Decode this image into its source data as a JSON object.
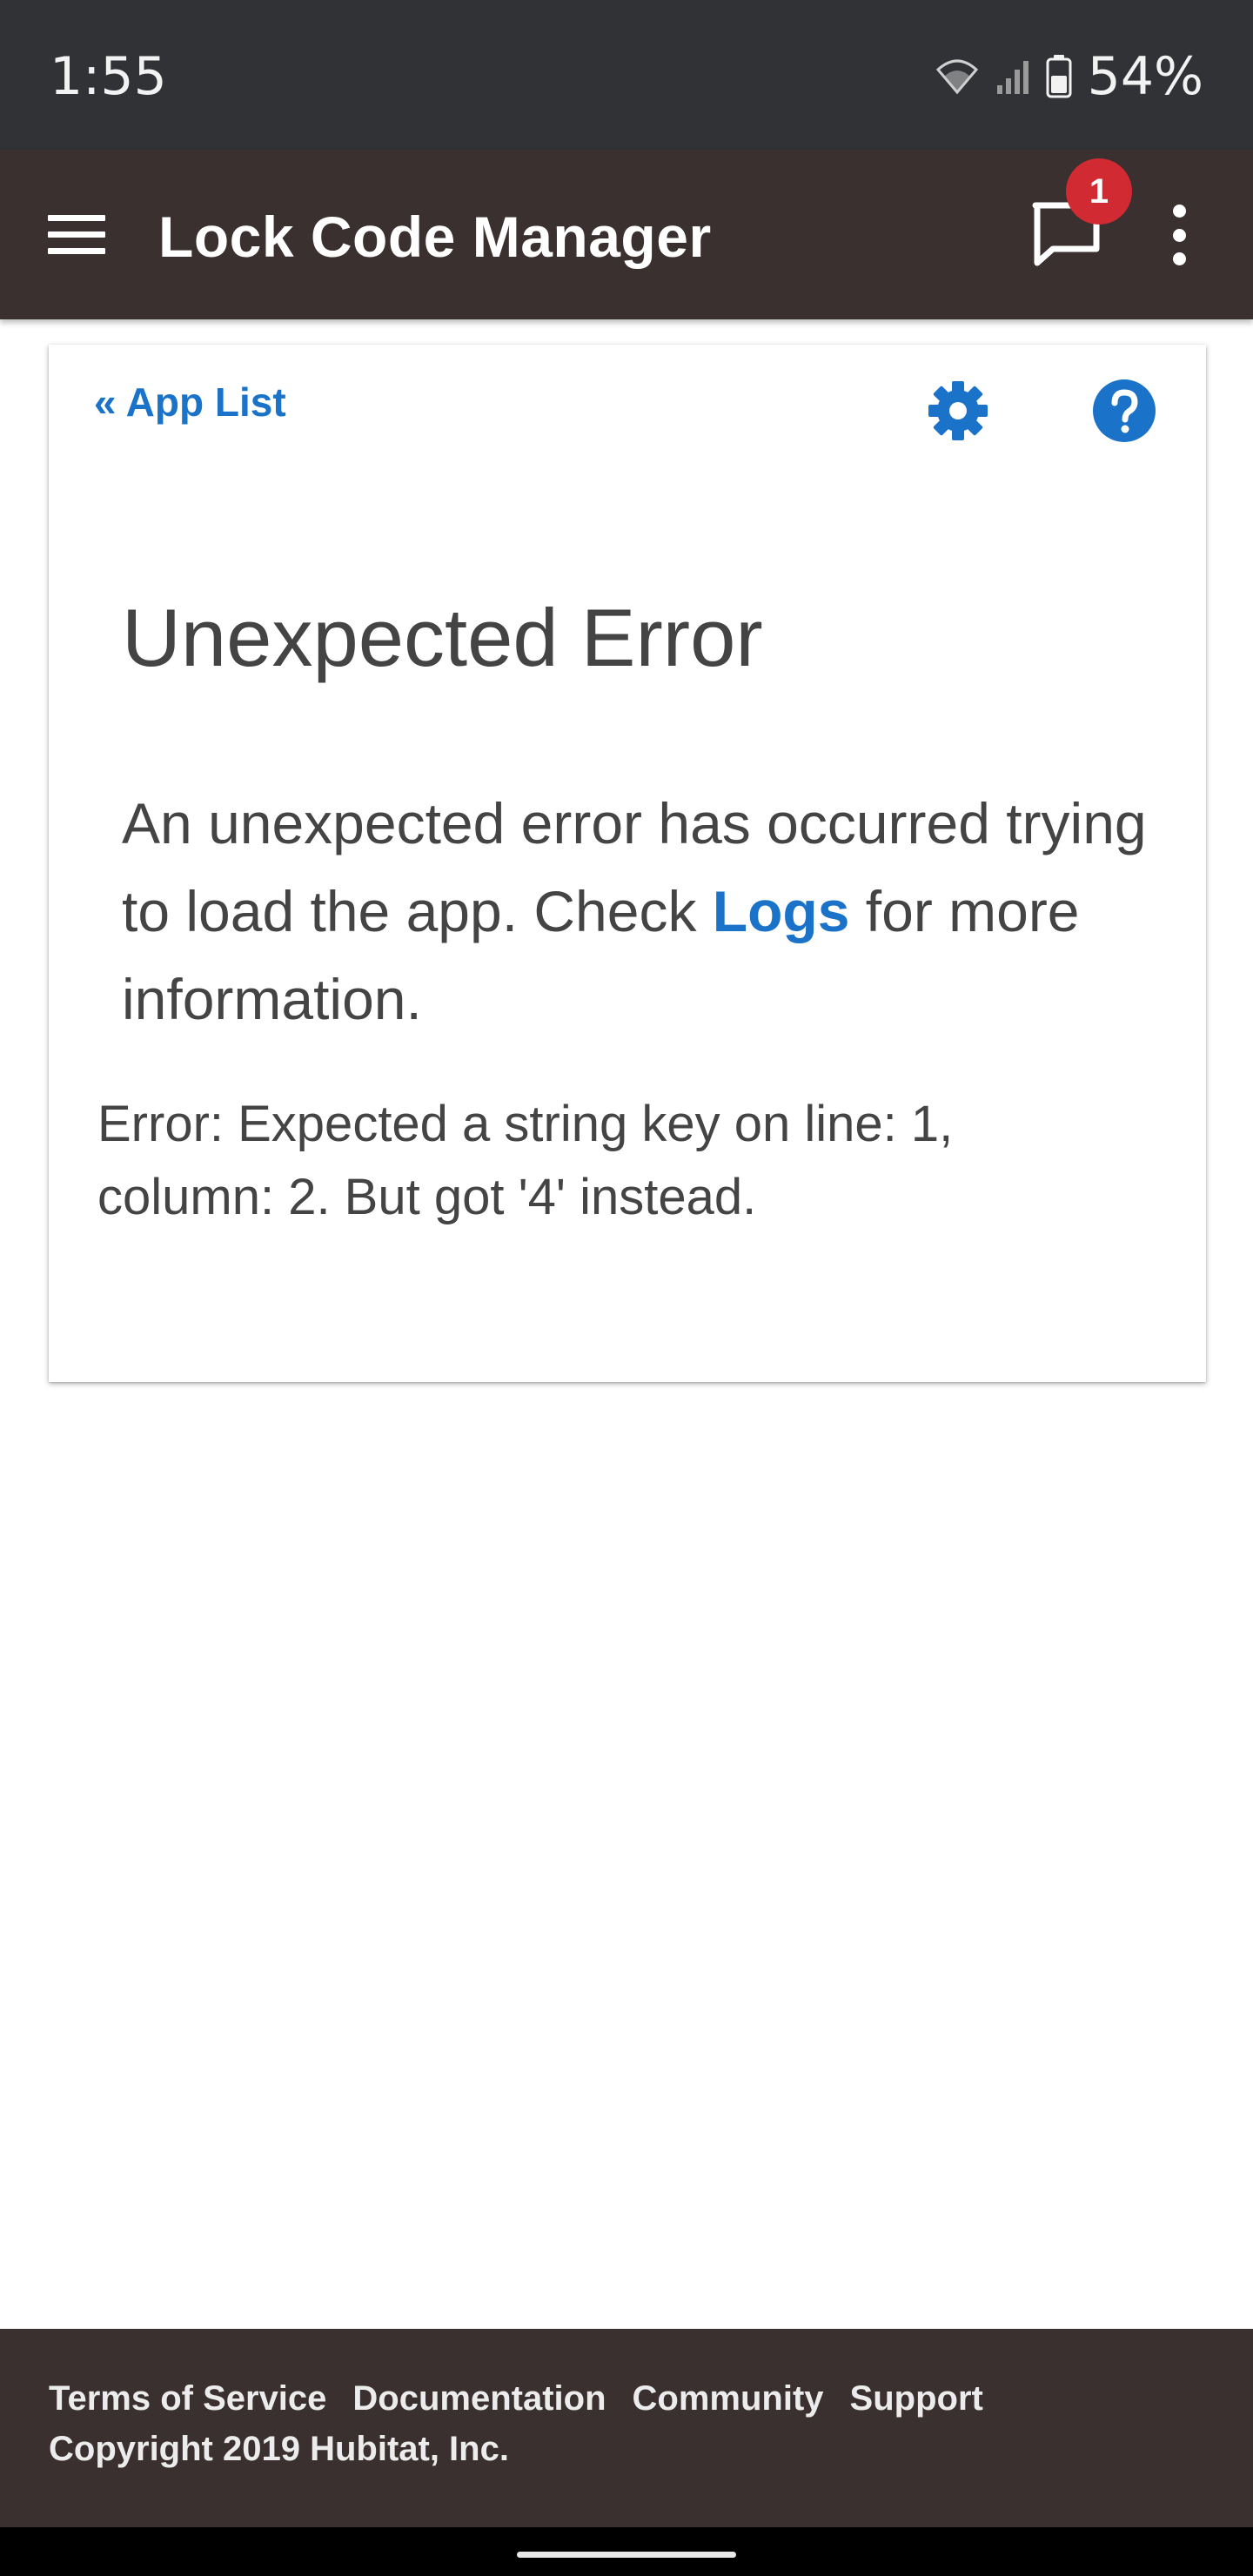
{
  "status_bar": {
    "time": "1:55",
    "battery_percent": "54%",
    "icons": [
      "wifi-icon",
      "cell-signal-icon",
      "battery-icon"
    ]
  },
  "app_bar": {
    "title": "Lock Code Manager",
    "menu_icon": "hamburger-menu-icon",
    "messages_icon": "chat-bubble-icon",
    "notification_count": "1",
    "overflow_icon": "more-vertical-icon"
  },
  "card": {
    "back_link": "« App List",
    "settings_icon": "gear-icon",
    "help_icon": "help-circle-icon",
    "error_title": "Unexpected Error",
    "error_message_before": "An unexpected error has occurred trying to load the app. Check ",
    "logs_link": "Logs",
    "error_message_after": " for more information.",
    "error_detail": "Error: Expected a string key on line: 1, column: 2. But got '4' instead."
  },
  "footer": {
    "links": [
      "Terms of Service",
      "Documentation",
      "Community",
      "Support"
    ],
    "copyright": "Copyright 2019 Hubitat, Inc."
  },
  "colors": {
    "status_bar": "#303236",
    "app_bar": "#3a302f",
    "accent": "#1a73c8",
    "badge": "#d22a33",
    "text": "#444444",
    "footer": "#3a302f"
  }
}
